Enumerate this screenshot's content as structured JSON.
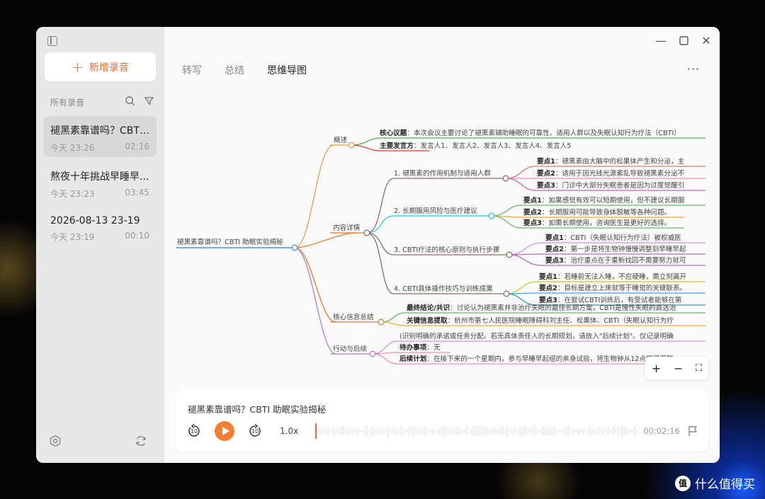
{
  "watermark": {
    "text": "什么值得买",
    "icon_text": "值"
  },
  "sidebar": {
    "new_button_label": "新增录音",
    "all_recordings_label": "所有录音",
    "recordings": [
      {
        "title": "褪黑素靠谱吗？CBTI...",
        "date": "今天 23:26",
        "duration": "02:16",
        "active": true
      },
      {
        "title": "熬夜十年挑战早睡早...",
        "date": "今天 23:23",
        "duration": "03:45",
        "active": false
      },
      {
        "title": "2026-08-13 23-19",
        "date": "今天 23:19",
        "duration": "00:10",
        "active": false
      }
    ]
  },
  "tabs": [
    {
      "label": "转写",
      "active": false
    },
    {
      "label": "总结",
      "active": false
    },
    {
      "label": "思维导图",
      "active": true
    }
  ],
  "more_label": "···",
  "mindmap": {
    "root": "褪黑素靠谱吗？CBTI 助眠实验揭秘",
    "branches": {
      "overview": "概述",
      "details": "内容详情",
      "core": "核心信息总结",
      "actions": "行动与后续"
    },
    "overview_items": [
      {
        "key": "核心议题",
        "text": "：本次会议主要讨论了褪黑素辅助睡眠的可靠性、适用人群以及失眠认知行为疗法（CBTI）"
      },
      {
        "key": "主要发言方",
        "text": "：发言人1、发言人2、发言人3、发言人4、发言人5"
      }
    ],
    "detail_topics": [
      "1. 褪黑素的作用机制与适用人群",
      "2. 长期服用风险与医疗建议",
      "3. CBTI疗法的核心原则与执行步骤",
      "4. CBTI具体操作技巧与训练成果"
    ],
    "topic_points": [
      [
        {
          "key": "要点1",
          "text": "：褪黑素由大脑中的松果体产生和分泌，主"
        },
        {
          "key": "要点2",
          "text": "：适用于因光线光源紊乱导致褪黑素分泌不"
        },
        {
          "key": "要点3",
          "text": "：门诊中大部分失眠患者是因为过度觉醒引"
        }
      ],
      [
        {
          "key": "要点1",
          "text": "：如果感觉有效可以短期使用，但不建议长期服"
        },
        {
          "key": "要点2",
          "text": "：长期服用可能导致身体脱敏等各种问题。"
        },
        {
          "key": "要点3",
          "text": "：如需长期使用，咨询医生是更好的选择。"
        }
      ],
      [
        {
          "key": "要点1",
          "text": "：CBTI（失眠认知行为疗法）被权威医"
        },
        {
          "key": "要点2",
          "text": "：第一步是将生物钟慢慢调整到早睡早起"
        },
        {
          "key": "要点3",
          "text": "：治疗重点在于重新找回不需要努力就可"
        }
      ],
      [
        {
          "key": "要点1",
          "text": "：若睡前无法入睡，不应硬睡，需立刻离开"
        },
        {
          "key": "要点2",
          "text": "：目标是建立上床就等于睡觉的关键联系。"
        },
        {
          "key": "要点3",
          "text": "：在尝试CBTI训练后，有受试者能够在第"
        }
      ]
    ],
    "core_items": [
      {
        "key": "最终结论/共识",
        "text": "：讨论认为褪黑素并非治疗失眠的最佳长期方案，CBTI是慢性失眠的首选治"
      },
      {
        "key": "关键信息提取",
        "text": "：杭州市第七人民医院睡眠障碍科刘主任、松果体、CBTI（失眠认知行为疗"
      }
    ],
    "action_note": "(识别明确的承诺或任务分配。若无具体责任人的长期规划，请放入\"后续计划\"。仅记录明确",
    "action_items": [
      {
        "key": "待办事项",
        "text": "：无"
      },
      {
        "key": "后续计划",
        "text": "：在接下来的一个星期内，参与早睡早起组的亲身试验，将生物钟从12点慢慢调整"
      }
    ]
  },
  "map_controls": {
    "zoom_in": "+",
    "zoom_out": "−",
    "fit": "⛶"
  },
  "player": {
    "title": "褪黑素靠谱吗？CBTI 助眠实验揭秘",
    "rewind_label": "10",
    "forward_label": "10",
    "speed": "1.0x",
    "time": "00:02:16",
    "progress": 0.0
  },
  "colors": {
    "accent": "#f26b2a",
    "overview": "#f39a3a",
    "details": "#e0802e",
    "core": "#e57a2a",
    "actions": "#b57ad8"
  }
}
